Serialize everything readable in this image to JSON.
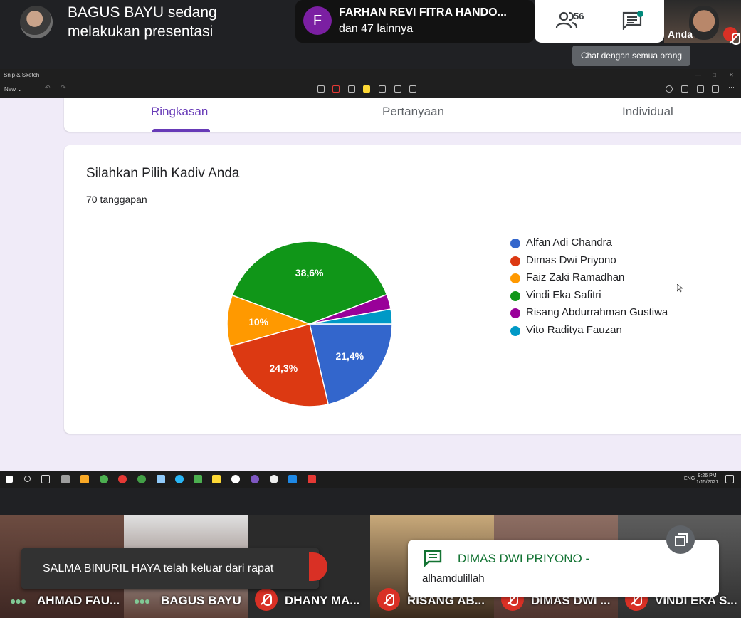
{
  "meet": {
    "presenter_line1": "BAGUS BAYU sedang",
    "presenter_line2": "melakukan presentasi",
    "pinned_initial": "F",
    "pinned_name": "FARHAN REVI FITRA HANDO...",
    "pinned_sub": "dan 47 lainnya",
    "people_count": "56",
    "self_label": "Anda",
    "chat_tooltip": "Chat dengan semua orang"
  },
  "snip": {
    "title": "Snip & Sketch",
    "new_label": "New"
  },
  "form": {
    "tabs": [
      "Ringkasan",
      "Pertanyaan",
      "Individual"
    ],
    "question_title": "Silahkan Pilih Kadiv Anda",
    "response_count": "70 tanggapan"
  },
  "chart_data": {
    "type": "pie",
    "title": "Silahkan Pilih Kadiv Anda",
    "labels": [
      "Alfan Adi Chandra",
      "Dimas Dwi Priyono",
      "Faiz Zaki Ramadhan",
      "Vindi Eka Safitri",
      "Risang Abdurrahman Gustiwa",
      "Vito Raditya Fauzan"
    ],
    "values": [
      21.4,
      24.3,
      10,
      38.6,
      2.9,
      2.9
    ],
    "value_labels": [
      "21,4%",
      "24,3%",
      "10%",
      "38,6%",
      "",
      ""
    ],
    "colors": [
      "#3366cc",
      "#dc3912",
      "#ff9900",
      "#109618",
      "#990099",
      "#0099c6"
    ],
    "legend_position": "right"
  },
  "taskbar": {
    "time": "9:26 PM",
    "date": "1/15/2021",
    "lang": "ENG"
  },
  "tiles": [
    {
      "name": "AHMAD FAU...",
      "status": "speaking"
    },
    {
      "name": "BAGUS BAYU",
      "status": "speaking"
    },
    {
      "name": "DHANY MA...",
      "status": "muted"
    },
    {
      "name": "RISANG AB...",
      "status": "muted"
    },
    {
      "name": "DIMAS DWI ...",
      "status": "muted"
    },
    {
      "name": "VINDI EKA S...",
      "status": "muted"
    }
  ],
  "toast": "SALMA BINURIL HAYA telah keluar dari rapat",
  "chat_popup": {
    "sender": "DIMAS DWI PRIYONO -",
    "message": "alhamdulillah"
  }
}
